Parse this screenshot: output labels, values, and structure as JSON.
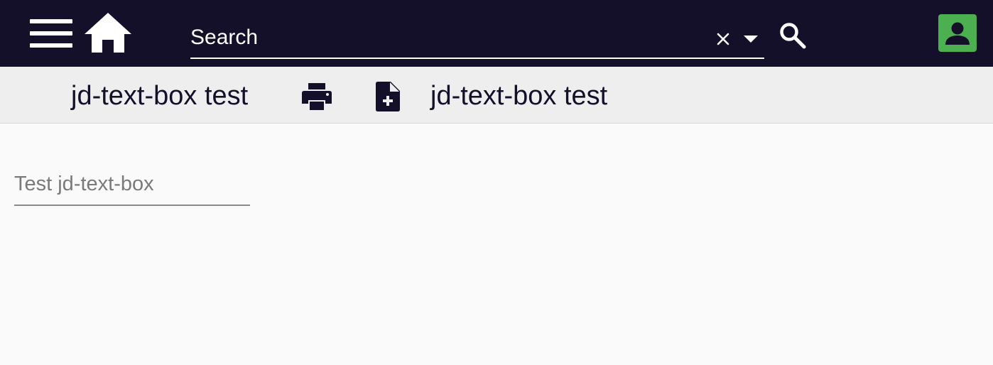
{
  "header": {
    "search": {
      "placeholder": "Search",
      "value": ""
    },
    "icons": {
      "menu": "menu-icon",
      "home": "home-icon",
      "clear": "close-icon",
      "dropdown": "caret-down-icon",
      "search": "search-icon",
      "account": "account-icon"
    },
    "colors": {
      "background": "#14102a",
      "account_accent": "#4caf50"
    }
  },
  "toolbar": {
    "title_left": "jd-text-box test",
    "title_right": "jd-text-box test",
    "icons": {
      "print": "print-icon",
      "new_document": "note-add-icon"
    }
  },
  "main": {
    "text_box": {
      "placeholder": "Test jd-text-box",
      "value": ""
    }
  }
}
